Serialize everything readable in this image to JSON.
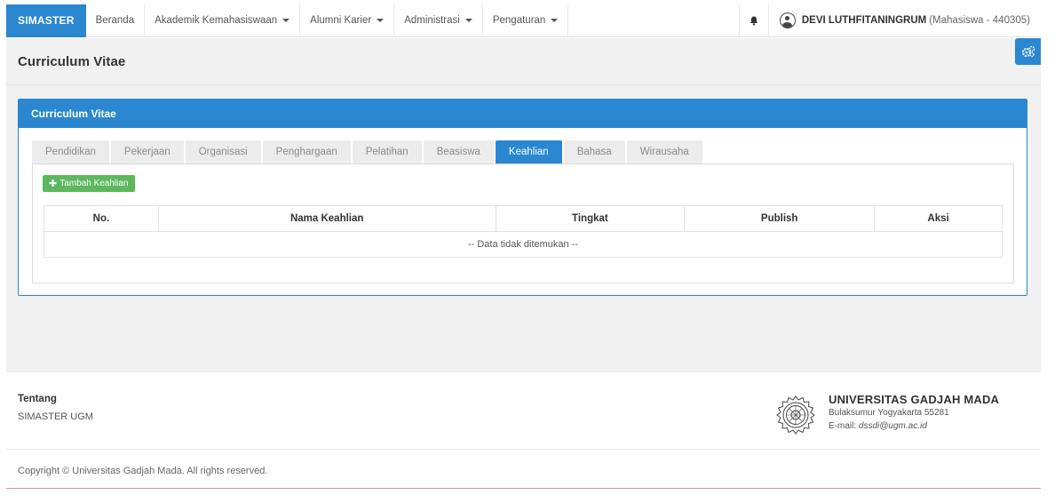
{
  "navbar": {
    "brand": "SIMASTER",
    "items": [
      {
        "label": "Beranda",
        "dropdown": false
      },
      {
        "label": "Akademik Kemahasiswaan",
        "dropdown": true
      },
      {
        "label": "Alumni Karier",
        "dropdown": true
      },
      {
        "label": "Administrasi",
        "dropdown": true
      },
      {
        "label": "Pengaturan",
        "dropdown": true
      }
    ],
    "user_name": "DEVI LUTHFITANINGRUM",
    "user_role": "(Mahasiswa - 440305)",
    "icons": {
      "notification": "bell-icon",
      "user": "user-circle-icon",
      "settings": "gears-icon"
    }
  },
  "page": {
    "title": "Curriculum Vitae"
  },
  "panel": {
    "title": "Curriculum Vitae",
    "tabs": [
      {
        "label": "Pendidikan",
        "active": false
      },
      {
        "label": "Pekerjaan",
        "active": false
      },
      {
        "label": "Organisasi",
        "active": false
      },
      {
        "label": "Penghargaan",
        "active": false
      },
      {
        "label": "Pelatihan",
        "active": false
      },
      {
        "label": "Beasiswa",
        "active": false
      },
      {
        "label": "Keahlian",
        "active": true
      },
      {
        "label": "Bahasa",
        "active": false
      },
      {
        "label": "Wirausaha",
        "active": false
      }
    ],
    "add_button": "Tambah Keahlian",
    "table": {
      "headers": [
        "No.",
        "Nama Keahlian",
        "Tingkat",
        "Publish",
        "Aksi"
      ],
      "empty_message": "-- Data tidak ditemukan --"
    }
  },
  "footer": {
    "about_title": "Tentang",
    "about_text": "SIMASTER UGM",
    "university": "UNIVERSITAS GADJAH MADA",
    "address": "Bulaksumur Yogyakarta 55281",
    "email_label": "E-mail: ",
    "email": "dssdi@ugm.ac.id",
    "copyright": "Copyright © Universitas Gadjah Mada. All rights reserved."
  },
  "colors": {
    "primary": "#2a87d0",
    "success": "#5cb85c",
    "page_bg": "#f1f1f1"
  }
}
